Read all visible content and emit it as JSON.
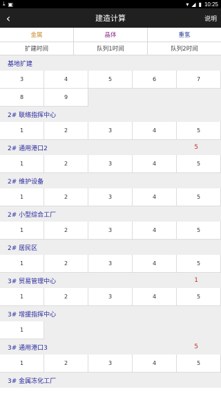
{
  "status": {
    "time": "10:25"
  },
  "appbar": {
    "title": "建造计算",
    "help": "说明"
  },
  "tabs": [
    {
      "label": "金属",
      "color": "#c98a2a"
    },
    {
      "label": "晶体",
      "color": "#8b2c8b"
    },
    {
      "label": "重氢",
      "color": "#2a3f9a"
    }
  ],
  "subtabs": [
    "扩建时间",
    "队列1时间",
    "队列2时间"
  ],
  "sections": [
    {
      "title": "基地扩建",
      "badge": "",
      "rows": [
        [
          "3",
          "4",
          "5",
          "6",
          "7"
        ],
        [
          "8",
          "9"
        ]
      ]
    },
    {
      "title": "2# 联络指挥中心",
      "badge": "",
      "rows": [
        [
          "1",
          "2",
          "3",
          "4",
          "5"
        ]
      ]
    },
    {
      "title": "2# 通用港口2",
      "badge": "5",
      "rows": [
        [
          "1",
          "2",
          "3",
          "4",
          "5"
        ]
      ]
    },
    {
      "title": "2# 维护设备",
      "badge": "",
      "rows": [
        [
          "1",
          "2",
          "3",
          "4",
          "5"
        ]
      ]
    },
    {
      "title": "2# 小型综合工厂",
      "badge": "",
      "rows": [
        [
          "1",
          "2",
          "3",
          "4",
          "5"
        ]
      ]
    },
    {
      "title": "2# 居民区",
      "badge": "",
      "rows": [
        [
          "1",
          "2",
          "3",
          "4",
          "5"
        ]
      ]
    },
    {
      "title": "3# 贸易管理中心",
      "badge": "1",
      "rows": [
        [
          "1",
          "2",
          "3",
          "4",
          "5"
        ]
      ]
    },
    {
      "title": "3# 增援指挥中心",
      "badge": "",
      "rows": [
        [
          "1"
        ]
      ]
    },
    {
      "title": "3# 通用港口3",
      "badge": "5",
      "rows": [
        [
          "1",
          "2",
          "3",
          "4",
          "5"
        ]
      ]
    },
    {
      "title": "3# 金属冻化工厂",
      "badge": "",
      "rows": []
    }
  ]
}
